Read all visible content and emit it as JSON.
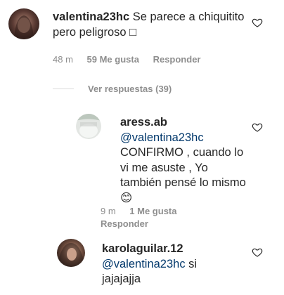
{
  "comments": [
    {
      "username": "valentina23hc",
      "text": "Se parece a chiquitito pero peligroso",
      "emoji": "□",
      "time": "48 m",
      "likes": "59 Me gusta",
      "reply": "Responder"
    }
  ],
  "view_replies": "Ver respuestas (39)",
  "replies": [
    {
      "username": "aress.ab",
      "mention": "@valentina23hc",
      "text_line1": "CONFIRMO , cuando lo",
      "text_line2": "vi me asuste , Yo",
      "text_line3": "también pensé lo mismo",
      "emoji": "😊",
      "time": "9 m",
      "likes": "1 Me gusta",
      "reply": "Responder"
    },
    {
      "username": "karolaguilar.12",
      "mention": "@valentina23hc",
      "text_line1": "si",
      "text_line2": "jajajajja"
    }
  ],
  "icons": {
    "heart": "heart-outline-icon"
  }
}
